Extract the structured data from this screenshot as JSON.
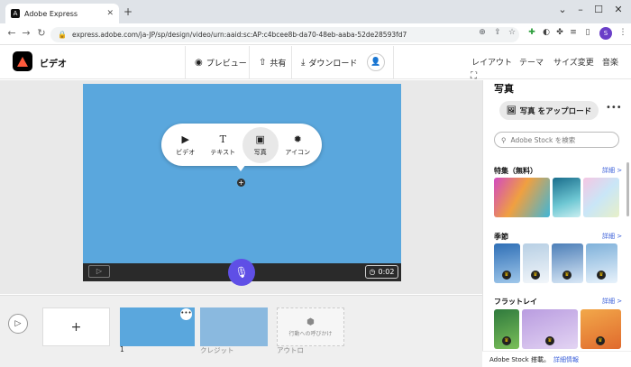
{
  "browser": {
    "tab_title": "Adobe Express",
    "url": "express.adobe.com/ja-JP/sp/design/video/urn:aaid:sc:AP:c4bcee8b-da70-48eb-aaba-52de28593fd7",
    "profile_initial": "S"
  },
  "app": {
    "project_title": "ビデオ",
    "header_buttons": {
      "preview": "プレビュー",
      "share": "共有",
      "download": "ダウンロード"
    },
    "right_tabs": {
      "layout": "レイアウト",
      "theme": "テーマ",
      "resize": "サイズ変更",
      "music": "音楽"
    }
  },
  "canvas": {
    "background_color": "#5aa7dd",
    "popup": {
      "video": "ビデオ",
      "text": "テキスト",
      "photo": "写真",
      "icon": "アイコン"
    },
    "timer": "0:02"
  },
  "timeline": {
    "clips": [
      {
        "label": "1"
      },
      {
        "label": "クレジット"
      },
      {
        "label": "アウトロ",
        "placeholder": "行動への呼びかけ"
      }
    ]
  },
  "panel": {
    "title": "写真",
    "upload_label": "写真 をアップロード",
    "search_placeholder": "Adobe Stock を検索",
    "sections": [
      {
        "title": "特集（無料）",
        "link": "詳細 >"
      },
      {
        "title": "季節",
        "link": "詳細 >"
      },
      {
        "title": "フラットレイ",
        "link": "詳細 >"
      }
    ],
    "footer_text": "Adobe Stock 搭載。",
    "footer_link": "詳細情報"
  }
}
